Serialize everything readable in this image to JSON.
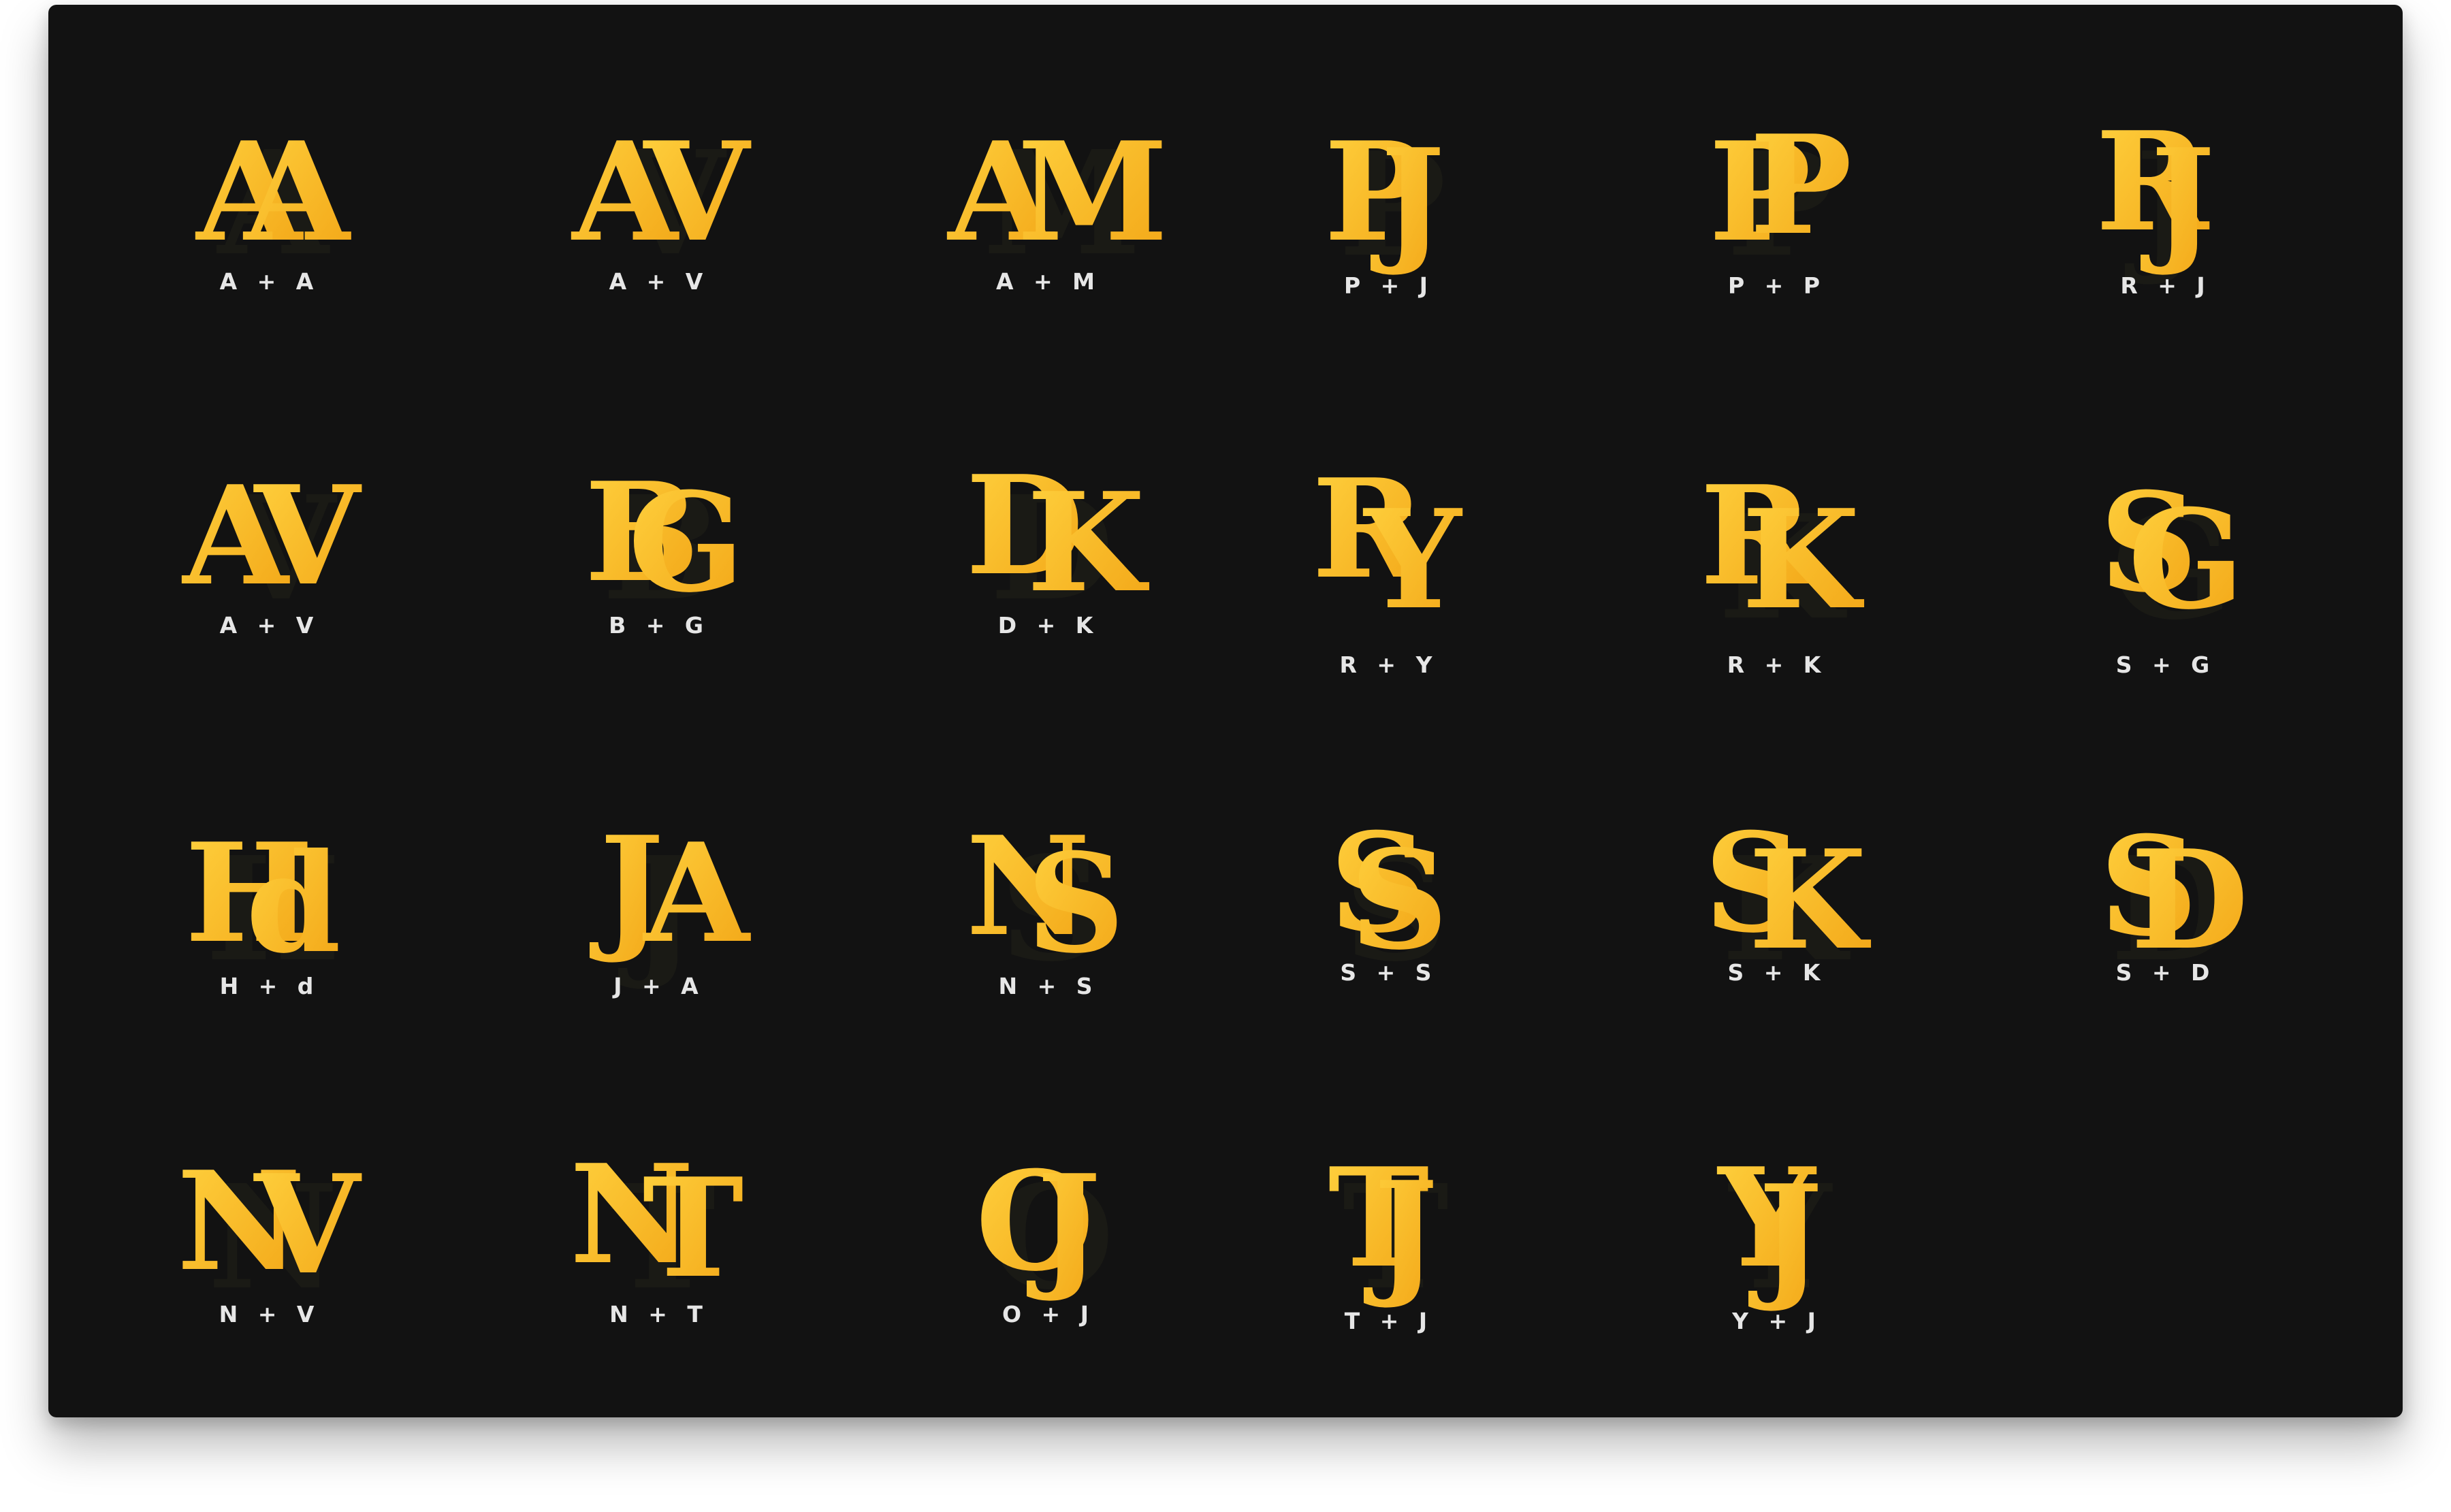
{
  "colors": {
    "background": "#121212",
    "gold_light": "#ffd23f",
    "gold_dark": "#f2a516",
    "label": "#e6e6e6"
  },
  "monograms": [
    {
      "first": "A",
      "second": "A",
      "label": "A + A"
    },
    {
      "first": "A",
      "second": "V",
      "label": "A + V"
    },
    {
      "first": "A",
      "second": "M",
      "label": "A + M"
    },
    {
      "first": "P",
      "second": "J",
      "label": "P + J"
    },
    {
      "first": "P",
      "second": "P",
      "label": "P + P"
    },
    {
      "first": "R",
      "second": "J",
      "label": "R + J"
    },
    {
      "first": "A",
      "second": "V",
      "label": "A + V"
    },
    {
      "first": "B",
      "second": "G",
      "label": "B + G"
    },
    {
      "first": "D",
      "second": "K",
      "label": "D + K"
    },
    {
      "first": "R",
      "second": "Y",
      "label": "R + Y"
    },
    {
      "first": "R",
      "second": "K",
      "label": "R + K"
    },
    {
      "first": "S",
      "second": "G",
      "label": "S + G"
    },
    {
      "first": "H",
      "second": "d",
      "label": "H + d"
    },
    {
      "first": "J",
      "second": "A",
      "label": "J + A"
    },
    {
      "first": "N",
      "second": "S",
      "label": "N + S"
    },
    {
      "first": "S",
      "second": "S",
      "label": "S + S"
    },
    {
      "first": "S",
      "second": "K",
      "label": "S + K"
    },
    {
      "first": "S",
      "second": "D",
      "label": "S + D"
    },
    {
      "first": "N",
      "second": "V",
      "label": "N + V"
    },
    {
      "first": "N",
      "second": "T",
      "label": "N + T"
    },
    {
      "first": "O",
      "second": "J",
      "label": "O + J"
    },
    {
      "first": "T",
      "second": "J",
      "label": "T + J"
    },
    {
      "first": "Y",
      "second": "J",
      "label": "Y + J"
    }
  ]
}
